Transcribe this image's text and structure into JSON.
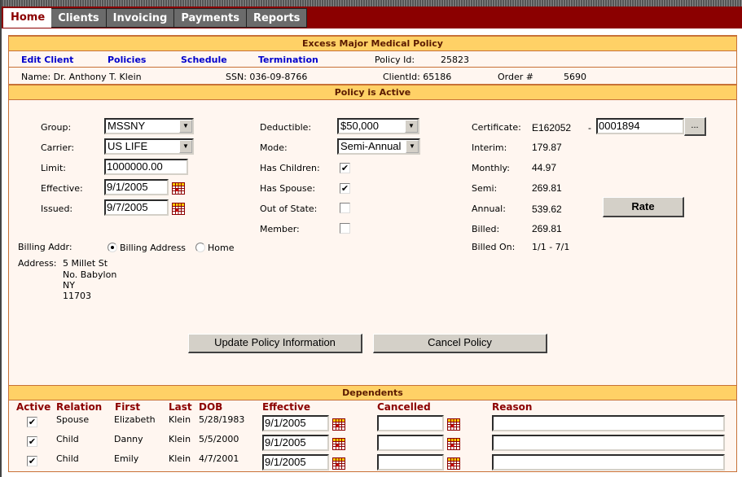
{
  "nav": {
    "tabs": [
      {
        "label": "Home",
        "active": true
      },
      {
        "label": "Clients",
        "active": false
      },
      {
        "label": "Invoicing",
        "active": false
      },
      {
        "label": "Payments",
        "active": false
      },
      {
        "label": "Reports",
        "active": false
      }
    ]
  },
  "policy": {
    "title": "Excess Major Medical Policy",
    "links": [
      "Edit Client",
      "Policies",
      "Schedule",
      "Termination"
    ],
    "policy_id_label": "Policy Id:",
    "policy_id": "25823",
    "name_label": "Name: Dr. Anthony T. Klein",
    "ssn_label": "SSN: 036-09-8766",
    "client_id_label": "ClientId: 65186",
    "order_label": "Order #",
    "order": "5690",
    "status": "Policy is Active"
  },
  "form": {
    "group_label": "Group:",
    "group": "MSSNY",
    "carrier_label": "Carrier:",
    "carrier": "US LIFE",
    "limit_label": "Limit:",
    "limit": "1000000.00",
    "effective_label": "Effective:",
    "effective": "9/1/2005",
    "issued_label": "Issued:",
    "issued": "9/7/2005",
    "deductible_label": "Deductible:",
    "deductible": "$50,000",
    "mode_label": "Mode:",
    "mode": "Semi-Annual",
    "has_children_label": "Has Children:",
    "has_children": true,
    "has_spouse_label": "Has Spouse:",
    "has_spouse": true,
    "out_of_state_label": "Out of State:",
    "out_of_state": false,
    "member_label": "Member:",
    "member": false,
    "certificate_label": "Certificate:",
    "certificate_prefix": "E162052",
    "certificate_sep": "-",
    "certificate_number": "0001894",
    "browse_label": "...",
    "interim_label": "Interim:",
    "interim": "179.87",
    "monthly_label": "Monthly:",
    "monthly": "44.97",
    "semi_label": "Semi:",
    "semi": "269.81",
    "annual_label": "Annual:",
    "annual": "539.62",
    "billed_label": "Billed:",
    "billed": "269.81",
    "billed_on_label": "Billed On:",
    "billed_on": "1/1 - 7/1",
    "rate_label": "Rate",
    "billing_addr_label": "Billing Addr:",
    "billing_options": [
      {
        "label": "Billing Address",
        "selected": true
      },
      {
        "label": "Home",
        "selected": false
      }
    ],
    "address_label": "Address:",
    "address_lines": [
      "5 Millet St",
      "No. Babylon",
      "NY",
      "11703"
    ],
    "update_label": "Update Policy Information",
    "cancel_label": "Cancel Policy"
  },
  "dependents": {
    "title": "Dependents",
    "columns": [
      "Active",
      "Relation",
      "First",
      "Last",
      "DOB",
      "Effective",
      "Cancelled",
      "Reason"
    ],
    "rows": [
      {
        "active": true,
        "relation": "Spouse",
        "first": "Elizabeth",
        "last": "Klein",
        "dob": "5/28/1983",
        "effective": "9/1/2005",
        "cancelled": "",
        "reason": ""
      },
      {
        "active": true,
        "relation": "Child",
        "first": "Danny",
        "last": "Klein",
        "dob": "5/5/2000",
        "effective": "9/1/2005",
        "cancelled": "",
        "reason": ""
      },
      {
        "active": true,
        "relation": "Child",
        "first": "Emily",
        "last": "Klein",
        "dob": "4/7/2001",
        "effective": "9/1/2005",
        "cancelled": "",
        "reason": ""
      }
    ]
  }
}
